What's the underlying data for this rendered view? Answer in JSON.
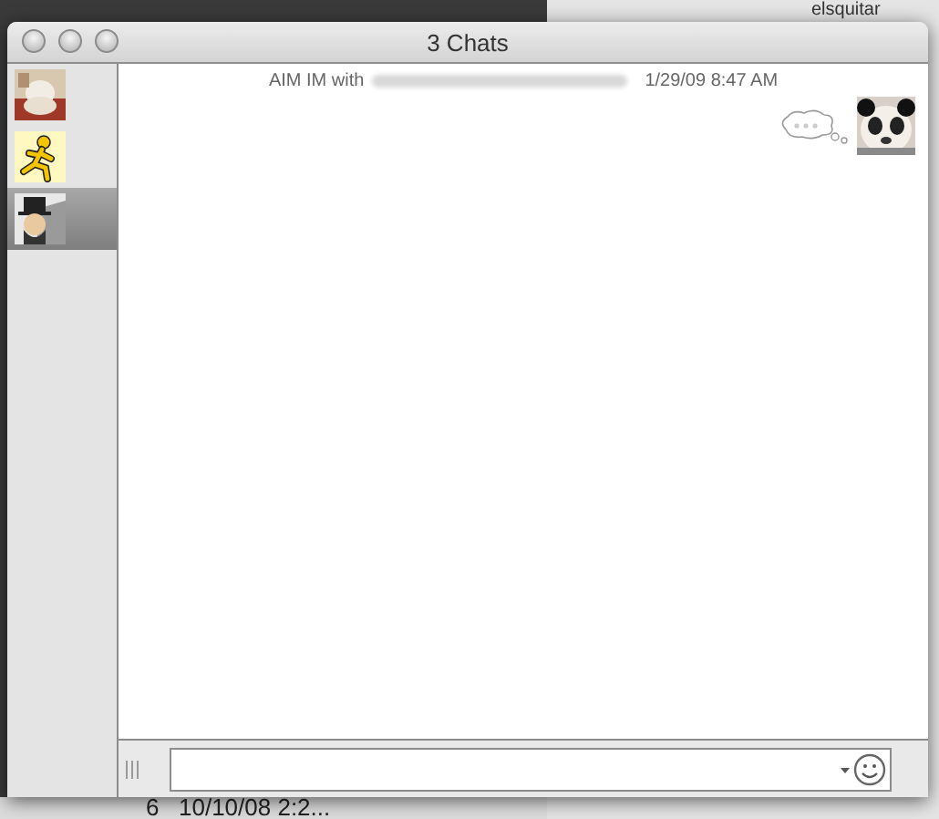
{
  "window": {
    "title": "3 Chats"
  },
  "chats": [
    {
      "kind": "picture",
      "selected": false
    },
    {
      "kind": "logo",
      "selected": false
    },
    {
      "kind": "picture",
      "selected": true
    }
  ],
  "header": {
    "label": "AIM IM with",
    "time": "1/29/09 8:47 AM"
  },
  "background": {
    "title": "elsquitar",
    "row": [
      "6",
      "10/10/08 2:2..."
    ]
  }
}
